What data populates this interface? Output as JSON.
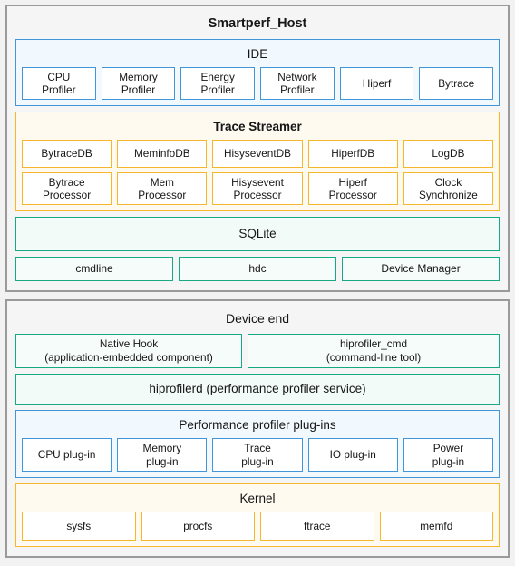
{
  "colors": {
    "blue": "#4295d6",
    "amber": "#f7b72c",
    "teal": "#17a884",
    "outline": "#9a9a9a",
    "page_background": "#f2f2f2"
  },
  "host": {
    "title": "Smartperf_Host",
    "ide": {
      "title": "IDE",
      "items": [
        "CPU\nProfiler",
        "Memory\nProfiler",
        "Energy\nProfiler",
        "Network\nProfiler",
        "Hiperf",
        "Bytrace"
      ]
    },
    "trace_streamer": {
      "title": "Trace Streamer",
      "databases": [
        "BytraceDB",
        "MeminfoDB",
        "HisyseventDB",
        "HiperfDB",
        "LogDB"
      ],
      "processors": [
        "Bytrace\nProcessor",
        "Mem\nProcessor",
        "Hisysevent\nProcessor",
        "Hiperf\nProcessor",
        "Clock\nSynchronize"
      ]
    },
    "sqlite": {
      "title": "SQLite"
    },
    "connectors": [
      "cmdline",
      "hdc",
      "Device Manager"
    ]
  },
  "device": {
    "title": "Device end",
    "tools": [
      "Native Hook\n(application-embedded component)",
      "hiprofiler_cmd\n(command-line tool)"
    ],
    "service": "hiprofilerd (performance profiler service)",
    "plugins": {
      "title": "Performance profiler plug-ins",
      "items": [
        "CPU plug-in",
        "Memory\nplug-in",
        "Trace\nplug-in",
        "IO plug-in",
        "Power\nplug-in"
      ]
    },
    "kernel": {
      "title": "Kernel",
      "items": [
        "sysfs",
        "procfs",
        "ftrace",
        "memfd"
      ]
    }
  }
}
